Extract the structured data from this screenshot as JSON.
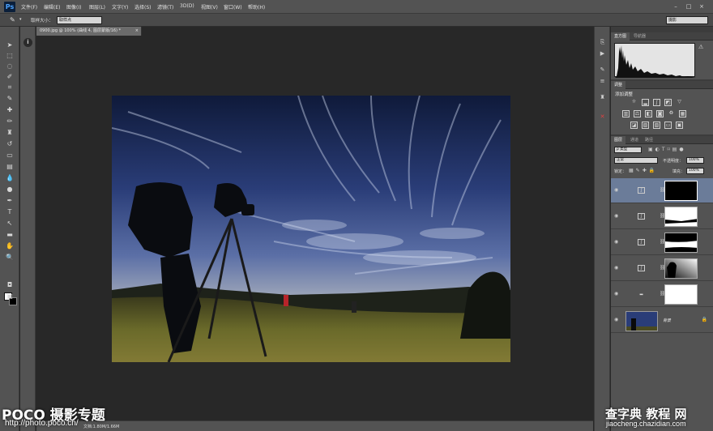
{
  "app": {
    "logo_text": "Ps"
  },
  "menu": [
    "文件(F)",
    "编辑(E)",
    "图像(I)",
    "图层(L)",
    "文字(Y)",
    "选择(S)",
    "滤镜(T)",
    "3D(D)",
    "视图(V)",
    "窗口(W)",
    "帮助(H)"
  ],
  "window_controls": {
    "minimize": "–",
    "maximize": "□",
    "close": "×"
  },
  "options": {
    "sample_size_label": "取样大小：",
    "sample_size_value": "取样点",
    "workspace_value": "摄影"
  },
  "document": {
    "tab_title": "0900.jpg @ 100% (曲线 4, 图层蒙版/16) *",
    "tab_close": "×"
  },
  "status": {
    "text": "文档:1.80M/1.66M"
  },
  "panels": {
    "histogram_tabs": [
      "直方图",
      "导航器"
    ],
    "histogram_warning": "⚠",
    "adjust_tabs": [
      "调整"
    ],
    "adjust_title": "添加调整",
    "layers_tabs": [
      "图层",
      "通道",
      "路径"
    ],
    "filter_kind": "ρ 类型",
    "blend_mode": "正常",
    "opacity_label": "不透明度：",
    "opacity_value": "100%",
    "lock_label": "锁定：",
    "fill_label": "填充：",
    "fill_value": "100%",
    "background_layer_name": "背景"
  },
  "watermarks": {
    "poco_title": "POCO 摄影专题",
    "poco_url": "http://photo.poco.cn/",
    "chazidian_title": "查字典 教程 网",
    "chazidian_url": "jiaocheng.chazidian.com"
  },
  "colors": {
    "menubar": "#535353",
    "panel": "#535353",
    "canvas_bg": "#282828",
    "selected_layer": "#6b7c99"
  }
}
